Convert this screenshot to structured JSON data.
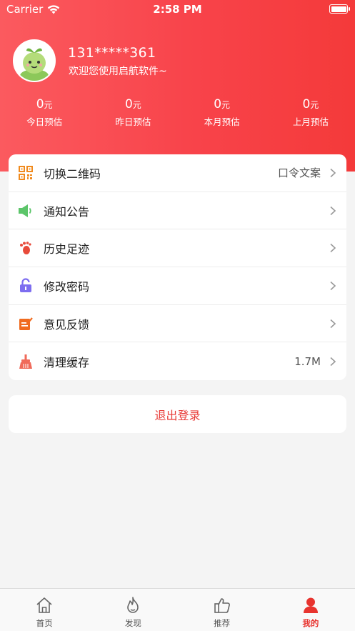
{
  "status_bar": {
    "carrier": "Carrier",
    "time": "2:58 PM"
  },
  "profile": {
    "phone": "131*****361",
    "welcome": "欢迎您使用启航软件~"
  },
  "stats": [
    {
      "amount": "0",
      "unit": "元",
      "label": "今日预估"
    },
    {
      "amount": "0",
      "unit": "元",
      "label": "昨日预估"
    },
    {
      "amount": "0",
      "unit": "元",
      "label": "本月预估"
    },
    {
      "amount": "0",
      "unit": "元",
      "label": "上月预估"
    }
  ],
  "menu": [
    {
      "label": "切换二维码",
      "value": "口令文案",
      "icon": "qrcode-icon",
      "color": "#f08a1d"
    },
    {
      "label": "通知公告",
      "value": "",
      "icon": "speaker-icon",
      "color": "#5cc56a"
    },
    {
      "label": "历史足迹",
      "value": "",
      "icon": "footprint-icon",
      "color": "#e84a3a"
    },
    {
      "label": "修改密码",
      "value": "",
      "icon": "lock-icon",
      "color": "#7d6df0"
    },
    {
      "label": "意见反馈",
      "value": "",
      "icon": "feedback-icon",
      "color": "#f06b1f"
    },
    {
      "label": "清理缓存",
      "value": "1.7M",
      "icon": "broom-icon",
      "color": "#f06a5a"
    }
  ],
  "logout_label": "退出登录",
  "tabs": [
    {
      "label": "首页",
      "icon": "home-icon",
      "active": false
    },
    {
      "label": "发现",
      "icon": "flame-icon",
      "active": false
    },
    {
      "label": "推荐",
      "icon": "thumbs-up-icon",
      "active": false
    },
    {
      "label": "我的",
      "icon": "user-icon",
      "active": true
    }
  ],
  "colors": {
    "accent": "#f8434a",
    "active_tab": "#e8342f"
  }
}
